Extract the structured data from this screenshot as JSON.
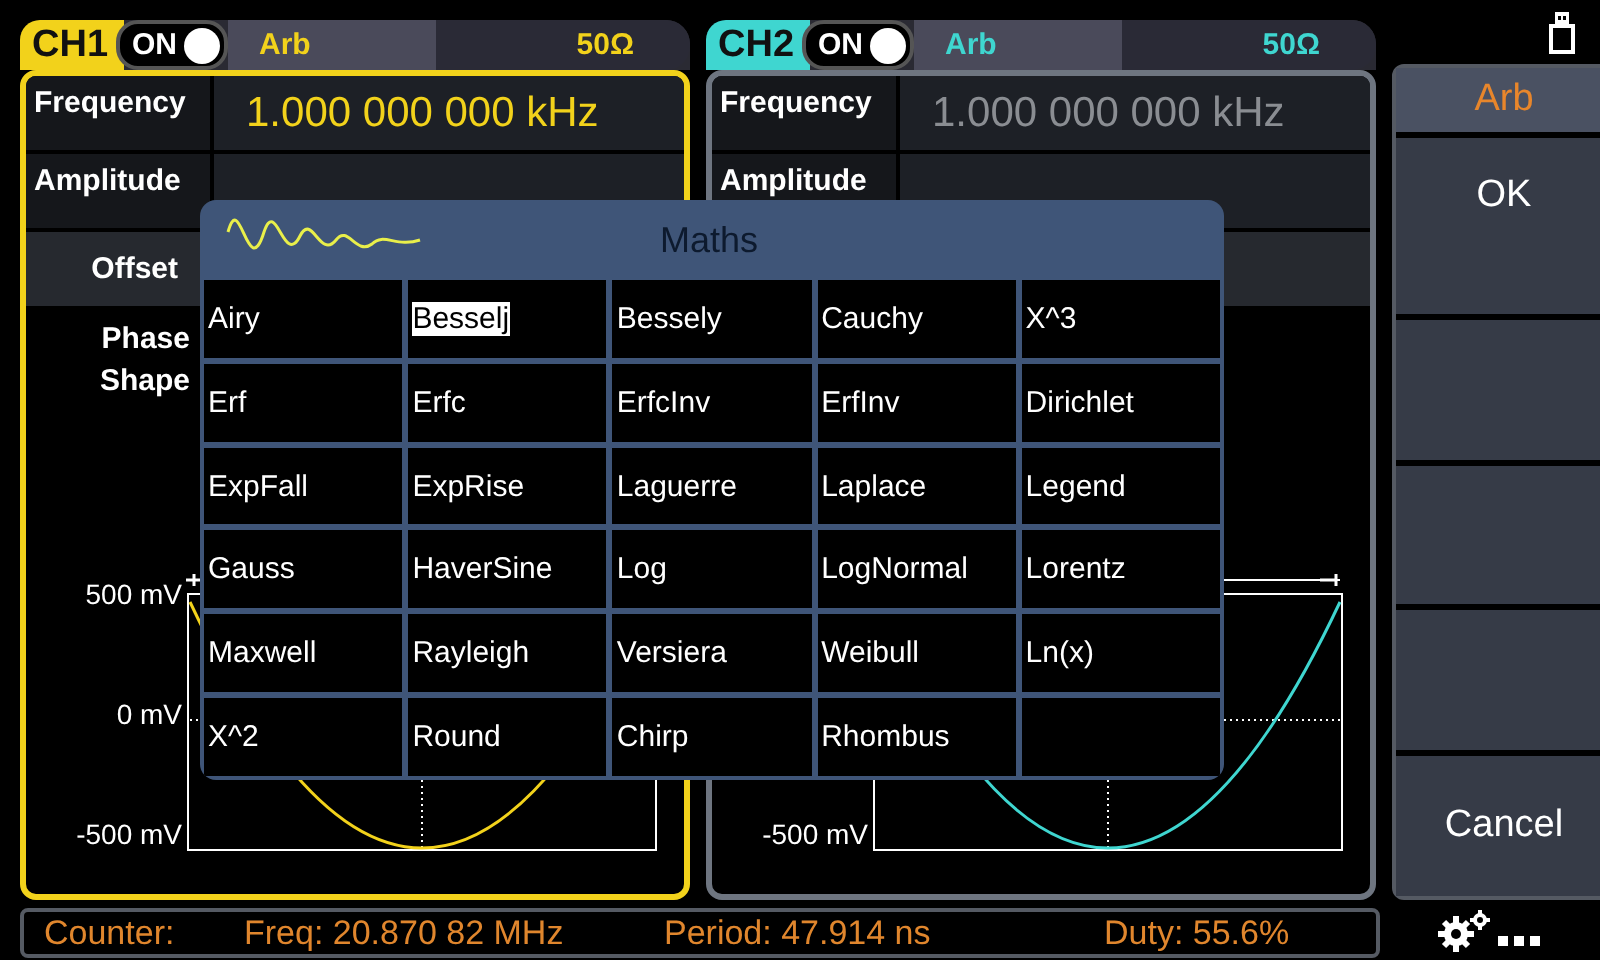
{
  "channels": [
    {
      "name": "CH1",
      "output": "ON",
      "on": true,
      "waveform": "Arb",
      "load": "50Ω",
      "color": "#f2d21b",
      "selected": true,
      "fields": [
        {
          "label": "Frequency",
          "value": "1.000 000 000 kHz"
        },
        {
          "label": "Amplitude"
        },
        {
          "label": "Offset"
        }
      ],
      "labels": [
        "Phase",
        "Shape"
      ],
      "axis_labels": [
        {
          "text": "500 mV",
          "kind": "top"
        },
        {
          "text": "0 mV",
          "kind": "middle"
        },
        {
          "text": "-500 mV",
          "kind": "bottom"
        }
      ]
    },
    {
      "name": "CH2",
      "output": "ON",
      "on": true,
      "waveform": "Arb",
      "load": "50Ω",
      "color": "#3fd6d0",
      "selected": false,
      "fields": [
        {
          "label": "Frequency",
          "value": "1.000 000 000 kHz"
        },
        {
          "label": "Amplitude"
        }
      ],
      "axis_labels": [
        {
          "text": "-500 mV",
          "kind": "bottom"
        }
      ]
    }
  ],
  "dialog": {
    "title": "Maths",
    "items": [
      {
        "label": "Airy",
        "selected": false
      },
      {
        "label": "Besselj",
        "selected": true
      },
      {
        "label": "Bessely",
        "selected": false
      },
      {
        "label": "Cauchy",
        "selected": false
      },
      {
        "label": "X^3",
        "selected": false
      },
      {
        "label": "Erf",
        "selected": false
      },
      {
        "label": "Erfc",
        "selected": false
      },
      {
        "label": "ErfcInv",
        "selected": false
      },
      {
        "label": "ErfInv",
        "selected": false
      },
      {
        "label": "Dirichlet",
        "selected": false
      },
      {
        "label": "ExpFall",
        "selected": false
      },
      {
        "label": "ExpRise",
        "selected": false
      },
      {
        "label": "Laguerre",
        "selected": false
      },
      {
        "label": "Laplace",
        "selected": false
      },
      {
        "label": "Legend",
        "selected": false
      },
      {
        "label": "Gauss",
        "selected": false
      },
      {
        "label": "HaverSine",
        "selected": false
      },
      {
        "label": "Log",
        "selected": false
      },
      {
        "label": "LogNormal",
        "selected": false
      },
      {
        "label": "Lorentz",
        "selected": false
      },
      {
        "label": "Maxwell",
        "selected": false
      },
      {
        "label": "Rayleigh",
        "selected": false
      },
      {
        "label": "Versiera",
        "selected": false
      },
      {
        "label": "Weibull",
        "selected": false
      },
      {
        "label": "Ln(x)",
        "selected": false
      },
      {
        "label": "X^2",
        "selected": false
      },
      {
        "label": "Round",
        "selected": false
      },
      {
        "label": "Chirp",
        "selected": false
      },
      {
        "label": "Rhombus",
        "selected": false
      }
    ]
  },
  "softkeys": [
    {
      "kind": "header",
      "label": "Arb"
    },
    {
      "kind": "button",
      "label": "OK"
    },
    {
      "kind": "blank"
    },
    {
      "kind": "blank"
    },
    {
      "kind": "blank"
    },
    {
      "kind": "button",
      "label": "Cancel"
    }
  ],
  "status_bar": [
    "Counter:",
    "Freq: 20.870 82 MHz",
    "Period: 47.914 ns",
    "Duty: 55.6%"
  ]
}
